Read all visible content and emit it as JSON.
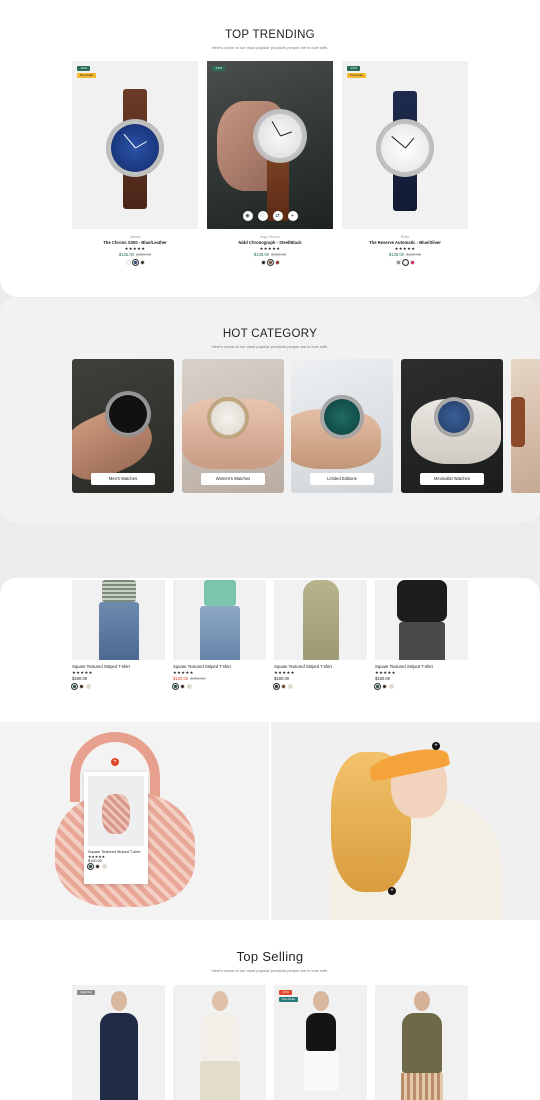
{
  "colors": {
    "accent": "#2b6b5a",
    "sale": "#e0472a",
    "badge": "#f5b82e"
  },
  "trending": {
    "title": "TOP TRENDING",
    "subtitle": "Here's some of our most popular products people are in love with.",
    "products": [
      {
        "badge1": "-15%",
        "badge2": "Pre-Order",
        "brand": "Gabriel",
        "name": "The Chrono S300 - Blue/Leather",
        "stars": "★★★★★",
        "price": "$135.00",
        "was": "$439.00"
      },
      {
        "badge1": "-15%",
        "badge2": "",
        "brand": "Hugo Fleurus",
        "name": "Nidd Chronograph - Steel/Black",
        "stars": "★★★★★",
        "price": "$135.00",
        "was": "$439.00"
      },
      {
        "badge1": "-15%",
        "badge2": "Pre-Order",
        "brand": "Rolex",
        "name": "The Reserve Automatic - Blue/Silver",
        "stars": "★★★★★",
        "price": "$135.00",
        "was": "$439.00"
      }
    ]
  },
  "category": {
    "title": "HOT CATEGORY",
    "subtitle": "Here's some of our most popular products people are in love with.",
    "items": [
      {
        "label": "Men's Watches"
      },
      {
        "label": "Women's Watches"
      },
      {
        "label": "Limited Editions"
      },
      {
        "label": "Minimalist Watches"
      }
    ]
  },
  "apparel": {
    "items": [
      {
        "name": "Square Textured Striped T-shirt",
        "stars": "★★★★★",
        "price": "$190.00",
        "was": ""
      },
      {
        "name": "Square Textured Striped T-shirt",
        "stars": "★★★★★",
        "price": "$130.00",
        "was": "$495.00"
      },
      {
        "name": "Square Textured Striped T-shirt",
        "stars": "★★★★★",
        "price": "$190.00",
        "was": ""
      },
      {
        "name": "Square Textured Striped T-shirt",
        "stars": "★★★★★",
        "price": "$190.00",
        "was": ""
      }
    ]
  },
  "lookbook": {
    "popup": {
      "name": "Square Textured Striped T-shirt",
      "stars": "★★★★★",
      "price": "$100.00"
    }
  },
  "top_selling": {
    "title": "Top Selling",
    "subtitle": "Here's some of our most popular products people are in love with.",
    "badges": {
      "sold_out": "Sold Out",
      "sale": "-15%",
      "preorder": "Pre-Order"
    }
  }
}
